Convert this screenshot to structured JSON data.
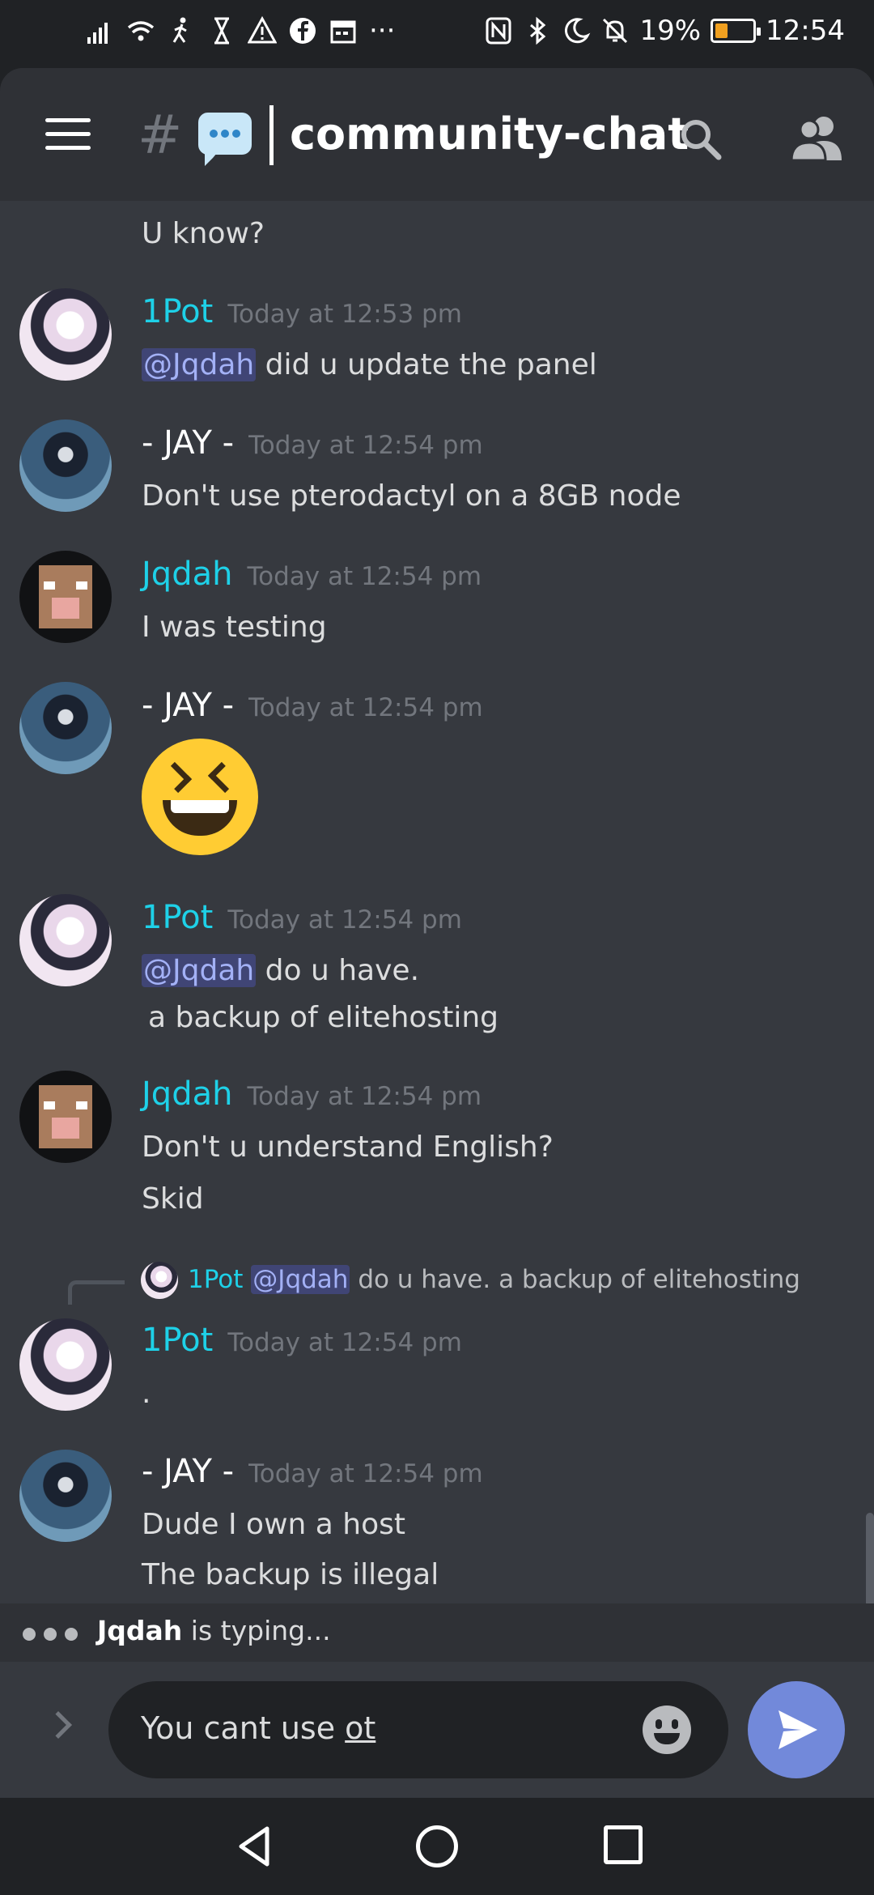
{
  "status_bar": {
    "battery": "19%",
    "time": "12:54"
  },
  "header": {
    "channel_name": "community-chat"
  },
  "chat": {
    "partial_message": "U know?",
    "messages": [
      {
        "author": "1Pot",
        "time": "Today at 12:53 pm",
        "mention": "@Jqdah",
        "lines": [
          "did u update the panel"
        ]
      },
      {
        "author": "- JAY -",
        "time": "Today at 12:54 pm",
        "lines": [
          "Don't use pterodactyl on a 8GB node"
        ]
      },
      {
        "author": "Jqdah",
        "time": "Today at 12:54 pm",
        "lines": [
          "I was testing"
        ]
      },
      {
        "author": "- JAY -",
        "time": "Today at 12:54 pm",
        "emoji": "grinning-squinting-face"
      },
      {
        "author": "1Pot",
        "time": "Today at 12:54 pm",
        "mention": "@Jqdah",
        "lines": [
          "do u have.",
          "a backup of elitehosting"
        ]
      },
      {
        "author": "Jqdah",
        "time": "Today at 12:54 pm",
        "lines": [
          "Don't u understand English?",
          "Skid"
        ]
      },
      {
        "author": "1Pot",
        "time": "Today at 12:54 pm",
        "lines": [
          "."
        ],
        "reply": {
          "author": "1Pot",
          "mention": "@Jqdah",
          "text": "do u have.  a backup of elitehosting"
        }
      },
      {
        "author": "- JAY -",
        "time": "Today at 12:54 pm",
        "lines": [
          "Dude I own a host",
          "The backup is illegal"
        ]
      }
    ]
  },
  "typing": {
    "user": "Jqdah",
    "text": "is typing..."
  },
  "composer": {
    "text_prefix": "You cant use ",
    "text_underlined": "ot"
  },
  "colors": {
    "accent": "#7289da",
    "username_cyan": "#1ed1e8",
    "background": "#36393f"
  }
}
